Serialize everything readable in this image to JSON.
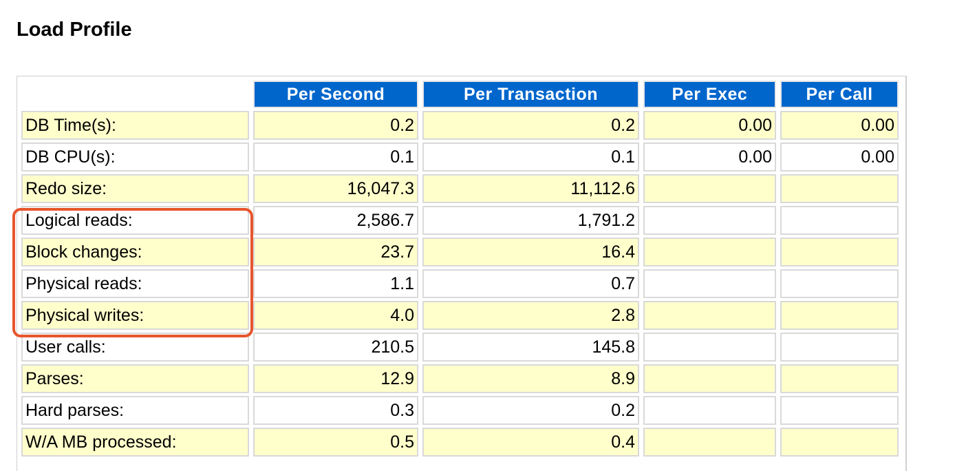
{
  "page": {
    "title": "Load Profile"
  },
  "colors": {
    "header_bg": "#0066cc",
    "header_text": "#ffffff",
    "row_alt_bg": "#ffffcc",
    "row_plain_bg": "#ffffff",
    "highlight_border": "#e8552d"
  },
  "table": {
    "columns": [
      "Per Second",
      "Per Transaction",
      "Per Exec",
      "Per Call"
    ],
    "rows": [
      {
        "label": "DB Time(s):",
        "per_second": "0.2",
        "per_transaction": "0.2",
        "per_exec": "0.00",
        "per_call": "0.00"
      },
      {
        "label": "DB CPU(s):",
        "per_second": "0.1",
        "per_transaction": "0.1",
        "per_exec": "0.00",
        "per_call": "0.00"
      },
      {
        "label": "Redo size:",
        "per_second": "16,047.3",
        "per_transaction": "11,112.6",
        "per_exec": "",
        "per_call": ""
      },
      {
        "label": "Logical reads:",
        "per_second": "2,586.7",
        "per_transaction": "1,791.2",
        "per_exec": "",
        "per_call": ""
      },
      {
        "label": "Block changes:",
        "per_second": "23.7",
        "per_transaction": "16.4",
        "per_exec": "",
        "per_call": ""
      },
      {
        "label": "Physical reads:",
        "per_second": "1.1",
        "per_transaction": "0.7",
        "per_exec": "",
        "per_call": ""
      },
      {
        "label": "Physical writes:",
        "per_second": "4.0",
        "per_transaction": "2.8",
        "per_exec": "",
        "per_call": ""
      },
      {
        "label": "User calls:",
        "per_second": "210.5",
        "per_transaction": "145.8",
        "per_exec": "",
        "per_call": ""
      },
      {
        "label": "Parses:",
        "per_second": "12.9",
        "per_transaction": "8.9",
        "per_exec": "",
        "per_call": ""
      },
      {
        "label": "Hard parses:",
        "per_second": "0.3",
        "per_transaction": "0.2",
        "per_exec": "",
        "per_call": ""
      },
      {
        "label": "W/A MB processed:",
        "per_second": "0.5",
        "per_transaction": "0.4",
        "per_exec": "",
        "per_call": ""
      }
    ]
  }
}
